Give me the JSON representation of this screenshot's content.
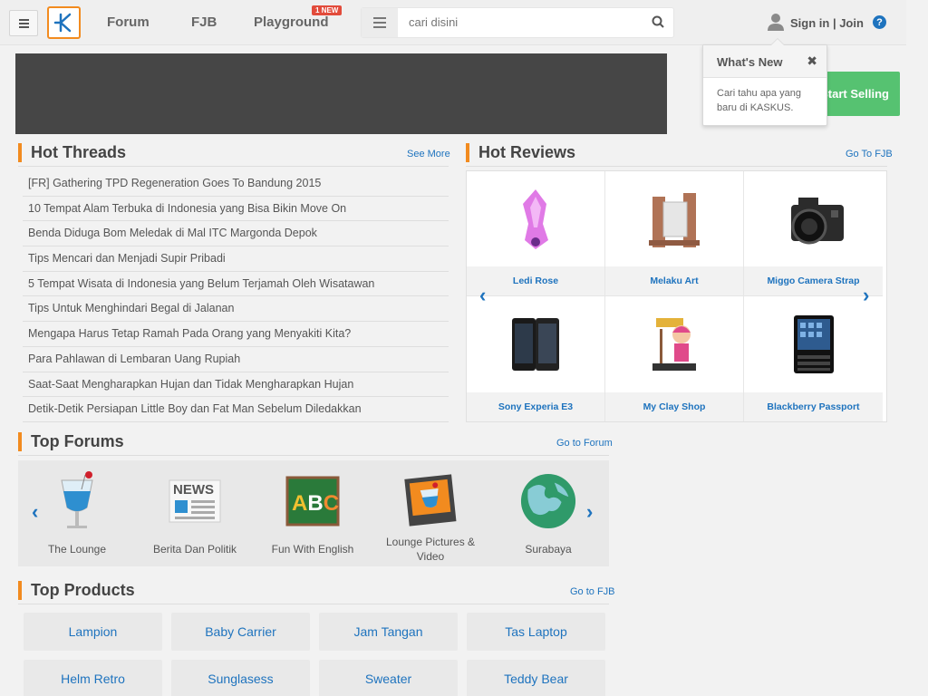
{
  "header": {
    "nav": [
      "Forum",
      "FJB",
      "Playground"
    ],
    "new_badge": "1 NEW",
    "search_placeholder": "cari disini",
    "signin": "Sign in | Join",
    "help": "?"
  },
  "banner": {
    "cta": "Start Selling"
  },
  "popup": {
    "title": "What's New",
    "close": "✖",
    "body": "Cari tahu apa yang baru di KASKUS."
  },
  "hot_threads": {
    "title": "Hot Threads",
    "link": "See More",
    "items": [
      "[FR] Gathering TPD Regeneration Goes To Bandung 2015",
      "10 Tempat Alam Terbuka di Indonesia yang Bisa Bikin Move On",
      "Benda Diduga Bom Meledak di Mal ITC Margonda Depok",
      "Tips Mencari dan Menjadi Supir Pribadi",
      "5 Tempat Wisata di Indonesia yang Belum Terjamah Oleh Wisatawan",
      "Tips Untuk Menghindari Begal di Jalanan",
      "Mengapa Harus Tetap Ramah Pada Orang yang Menyakiti Kita?",
      "Para Pahlawan di Lembaran Uang Rupiah",
      "Saat-Saat Mengharapkan Hujan dan Tidak Mengharapkan Hujan",
      "Detik-Detik Persiapan Little Boy dan Fat Man Sebelum Diledakkan"
    ]
  },
  "hot_reviews": {
    "title": "Hot Reviews",
    "link": "Go To FJB",
    "items": [
      "Ledi Rose",
      "Melaku Art",
      "Miggo Camera Strap",
      "Sony Experia E3",
      "My Clay Shop",
      "Blackberry Passport"
    ]
  },
  "top_forums": {
    "title": "Top Forums",
    "link": "Go to Forum",
    "items": [
      "The Lounge",
      "Berita Dan Politik",
      "Fun With English",
      "Lounge Pictures & Video",
      "Surabaya"
    ]
  },
  "top_products": {
    "title": "Top Products",
    "link": "Go to FJB",
    "items": [
      "Lampion",
      "Baby Carrier",
      "Jam Tangan",
      "Tas Laptop",
      "Helm Retro",
      "Sunglasess",
      "Sweater",
      "Teddy Bear"
    ]
  },
  "colors": {
    "accent": "#f28b1f",
    "link": "#1e73be",
    "cta": "#56c271",
    "badge": "#e24b3b"
  }
}
